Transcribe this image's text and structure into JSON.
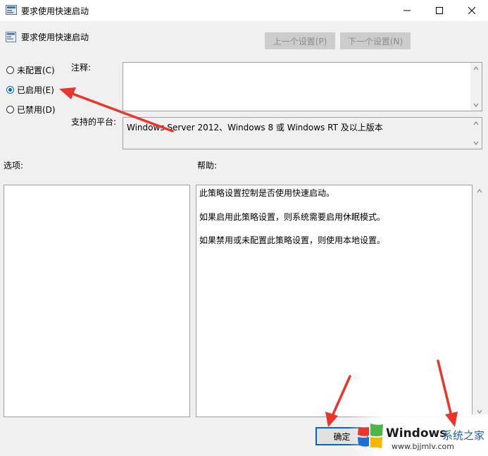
{
  "window": {
    "title": "要求使用快速启动",
    "minimize_icon": "minimize-icon",
    "maximize_icon": "maximize-icon",
    "close_icon": "close-icon"
  },
  "header": {
    "policy_name": "要求使用快速启动",
    "prev_setting": "上一个设置(P)",
    "next_setting": "下一个设置(N)"
  },
  "state": {
    "options": [
      {
        "label": "未配置(C)",
        "checked": false
      },
      {
        "label": "已启用(E)",
        "checked": true
      },
      {
        "label": "已禁用(D)",
        "checked": false
      }
    ]
  },
  "comment": {
    "label": "注释:",
    "value": ""
  },
  "platform": {
    "label": "支持的平台:",
    "value": "Windows Server 2012、Windows 8 或 Windows RT 及以上版本"
  },
  "options_label": "选项:",
  "help": {
    "label": "帮助:",
    "lines": [
      "此策略设置控制是否使用快速启动。",
      "如果启用此策略设置，则系统需要启用休眠模式。",
      "如果禁用或未配置此策略设置，则使用本地设置。"
    ]
  },
  "footer": {
    "ok_label": "确定"
  },
  "watermark": {
    "brand": "Windows",
    "brand_cn": "系统之家",
    "url": "www.bjjmlv.com"
  },
  "colors": {
    "accent": "#0067c0",
    "annotation_arrow": "#e8372a"
  }
}
